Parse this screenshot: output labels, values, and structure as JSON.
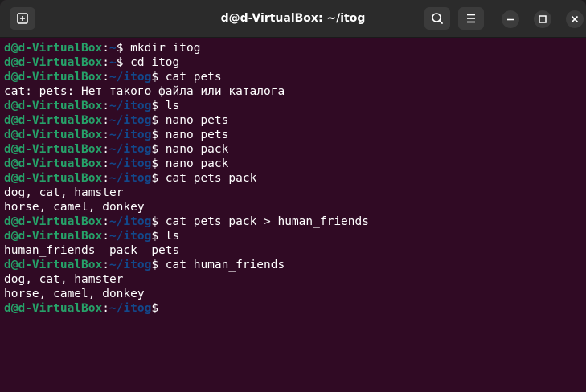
{
  "window": {
    "title": "d@d-VirtualBox: ~/itog"
  },
  "toolbar": {
    "new_tab_icon": "new-tab-icon",
    "search_icon": "search-icon",
    "menu_icon": "hamburger-menu-icon",
    "minimize_icon": "minimize-icon",
    "maximize_icon": "maximize-icon",
    "close_icon": "close-icon"
  },
  "colors": {
    "terminal_bg": "#300a24",
    "titlebar_bg": "#2b2b2b",
    "prompt_user": "#26a269",
    "prompt_path": "#12488b",
    "text": "#ffffff"
  },
  "terminal": {
    "lines": [
      {
        "type": "prompt",
        "user": "d@d-VirtualBox",
        "sep": ":",
        "path": "~",
        "symbol": "$",
        "command": " mkdir itog"
      },
      {
        "type": "prompt",
        "user": "d@d-VirtualBox",
        "sep": ":",
        "path": "~",
        "symbol": "$",
        "command": " cd itog"
      },
      {
        "type": "prompt",
        "user": "d@d-VirtualBox",
        "sep": ":",
        "path": "~/itog",
        "symbol": "$",
        "command": " cat pets"
      },
      {
        "type": "output",
        "text": "cat: pets: Нет такого файла или каталога"
      },
      {
        "type": "prompt",
        "user": "d@d-VirtualBox",
        "sep": ":",
        "path": "~/itog",
        "symbol": "$",
        "command": " ls"
      },
      {
        "type": "prompt",
        "user": "d@d-VirtualBox",
        "sep": ":",
        "path": "~/itog",
        "symbol": "$",
        "command": " nano pets"
      },
      {
        "type": "prompt",
        "user": "d@d-VirtualBox",
        "sep": ":",
        "path": "~/itog",
        "symbol": "$",
        "command": " nano pets"
      },
      {
        "type": "prompt",
        "user": "d@d-VirtualBox",
        "sep": ":",
        "path": "~/itog",
        "symbol": "$",
        "command": " nano pack"
      },
      {
        "type": "prompt",
        "user": "d@d-VirtualBox",
        "sep": ":",
        "path": "~/itog",
        "symbol": "$",
        "command": " nano pack"
      },
      {
        "type": "prompt",
        "user": "d@d-VirtualBox",
        "sep": ":",
        "path": "~/itog",
        "symbol": "$",
        "command": " cat pets pack"
      },
      {
        "type": "output",
        "text": "dog, cat, hamster"
      },
      {
        "type": "output",
        "text": "horse, camel, donkey"
      },
      {
        "type": "prompt",
        "user": "d@d-VirtualBox",
        "sep": ":",
        "path": "~/itog",
        "symbol": "$",
        "command": " cat pets pack > human_friends"
      },
      {
        "type": "prompt",
        "user": "d@d-VirtualBox",
        "sep": ":",
        "path": "~/itog",
        "symbol": "$",
        "command": " ls"
      },
      {
        "type": "output",
        "text": "human_friends  pack  pets"
      },
      {
        "type": "prompt",
        "user": "d@d-VirtualBox",
        "sep": ":",
        "path": "~/itog",
        "symbol": "$",
        "command": " cat human_friends"
      },
      {
        "type": "output",
        "text": "dog, cat, hamster"
      },
      {
        "type": "output",
        "text": "horse, camel, donkey"
      },
      {
        "type": "prompt",
        "user": "d@d-VirtualBox",
        "sep": ":",
        "path": "~/itog",
        "symbol": "$",
        "command": ""
      }
    ]
  }
}
